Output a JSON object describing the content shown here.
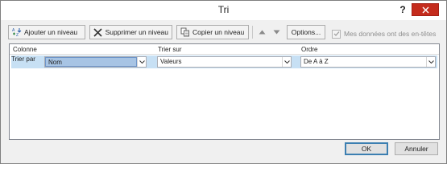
{
  "window": {
    "title": "Tri",
    "help_label": "?"
  },
  "toolbar": {
    "add_level": "Ajouter un niveau",
    "delete_level": "Supprimer un niveau",
    "copy_level": "Copier un niveau",
    "options": "Options...",
    "headers_checkbox": "Mes données ont des en-têtes",
    "headers_checked": true
  },
  "grid": {
    "columns": [
      "Colonne",
      "Trier sur",
      "Ordre"
    ],
    "rows": [
      {
        "label": "Trier par",
        "column": "Nom",
        "sort_on": "Valeurs",
        "order": "De A à Z"
      }
    ]
  },
  "footer": {
    "ok": "OK",
    "cancel": "Annuler"
  },
  "colors": {
    "close_red": "#c42b1c",
    "row_highlight": "#c7e0f4",
    "selection": "#a7c4e4"
  },
  "icons": [
    "add-level-icon",
    "delete-level-icon",
    "copy-level-icon",
    "move-up-icon",
    "move-down-icon",
    "close-icon",
    "dropdown-arrow-icon"
  ]
}
